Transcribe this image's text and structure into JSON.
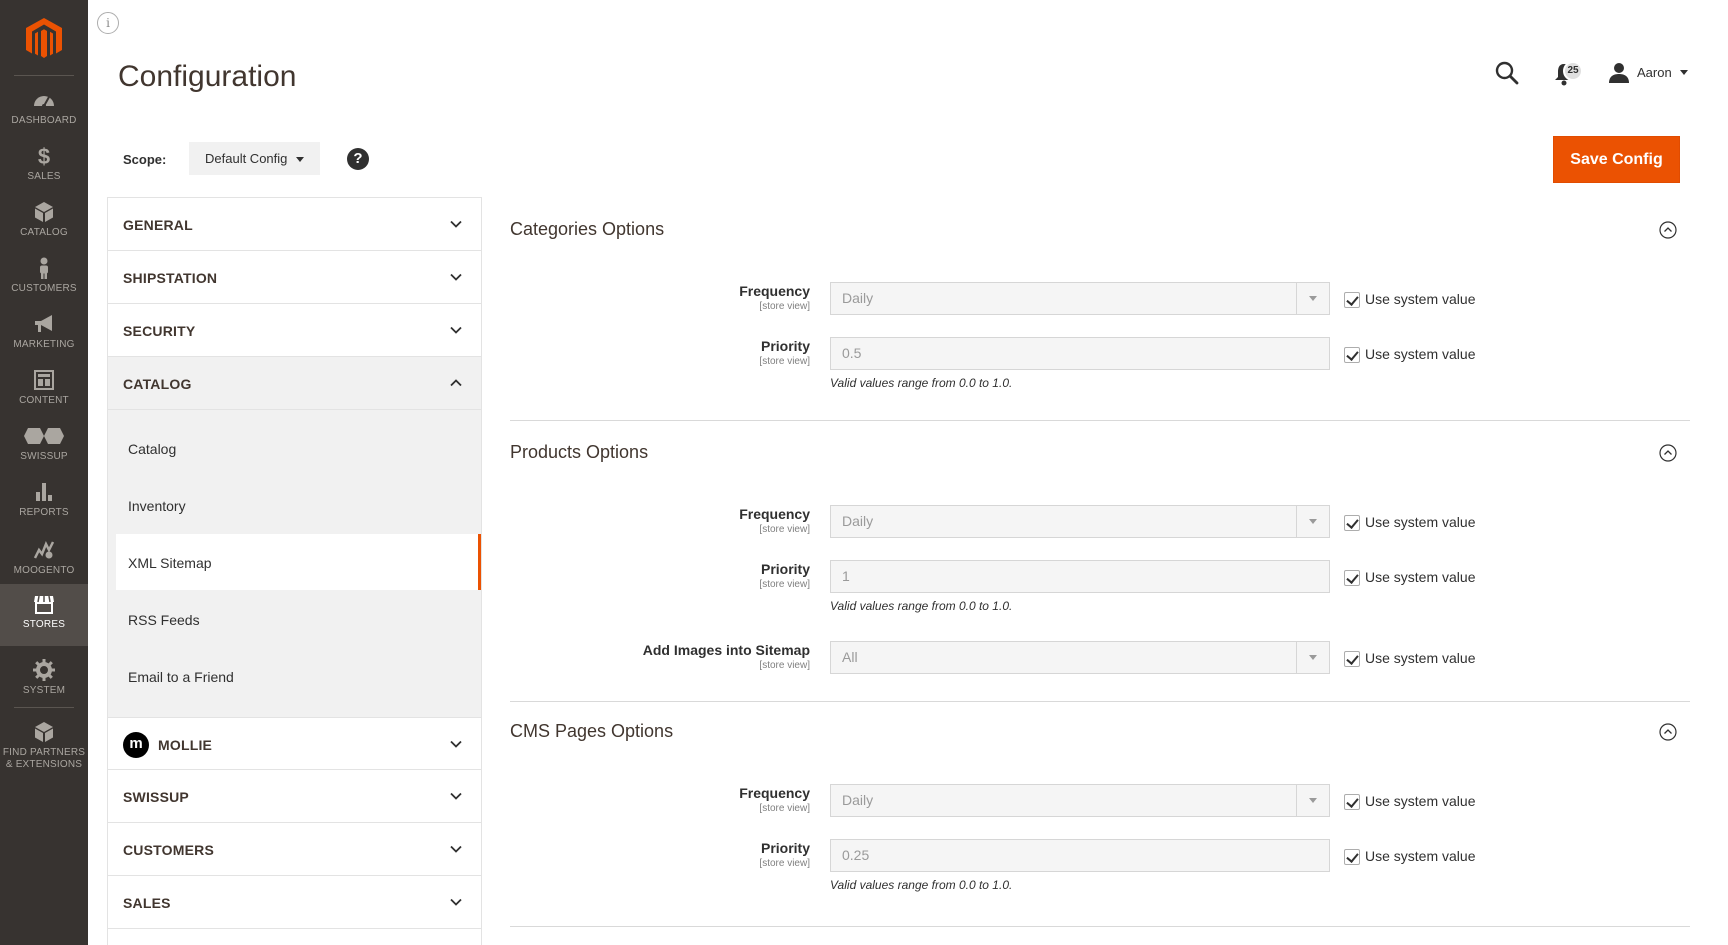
{
  "sidebar": {
    "items": [
      {
        "label": "DASHBOARD",
        "icon": "dashboard-icon"
      },
      {
        "label": "SALES",
        "icon": "dollar-icon"
      },
      {
        "label": "CATALOG",
        "icon": "box-icon"
      },
      {
        "label": "CUSTOMERS",
        "icon": "person-icon"
      },
      {
        "label": "MARKETING",
        "icon": "megaphone-icon"
      },
      {
        "label": "CONTENT",
        "icon": "layout-icon"
      },
      {
        "label": "SWISSUP",
        "icon": "swissup-icon"
      },
      {
        "label": "REPORTS",
        "icon": "bar-chart-icon"
      },
      {
        "label": "MOOGENTO",
        "icon": "moogento-icon"
      },
      {
        "label": "STORES",
        "icon": "store-icon",
        "active": true
      },
      {
        "label": "SYSTEM",
        "icon": "gear-icon"
      },
      {
        "label": "FIND PARTNERS & EXTENSIONS",
        "icon": "extensions-icon"
      }
    ]
  },
  "header": {
    "title": "Configuration",
    "notifications_count": "25",
    "user_name": "Aaron"
  },
  "scope": {
    "label": "Scope:",
    "value": "Default Config"
  },
  "actions": {
    "save_label": "Save Config"
  },
  "tabs": {
    "general": "GENERAL",
    "shipstation": "SHIPSTATION",
    "security": "SECURITY",
    "catalog": "CATALOG",
    "catalog_items": [
      "Catalog",
      "Inventory",
      "XML Sitemap",
      "RSS Feeds",
      "Email to a Friend"
    ],
    "catalog_active": "XML Sitemap",
    "mollie": "MOLLIE",
    "swissup": "SWISSUP",
    "customers": "CUSTOMERS",
    "sales": "SALES"
  },
  "common": {
    "store_view": "[store view]",
    "use_system_value": "Use system value",
    "valid_range_note": "Valid values range from 0.0 to 1.0."
  },
  "sections": {
    "categories": {
      "title": "Categories Options",
      "frequency_label": "Frequency",
      "frequency_value": "Daily",
      "priority_label": "Priority",
      "priority_value": "0.5"
    },
    "products": {
      "title": "Products Options",
      "frequency_label": "Frequency",
      "frequency_value": "Daily",
      "priority_label": "Priority",
      "priority_value": "1",
      "images_label": "Add Images into Sitemap",
      "images_value": "All"
    },
    "cms": {
      "title": "CMS Pages Options",
      "frequency_label": "Frequency",
      "frequency_value": "Daily",
      "priority_label": "Priority",
      "priority_value": "0.25"
    }
  },
  "colors": {
    "accent": "#eb5202",
    "menu_bg": "#373330",
    "menu_active": "#524d49"
  }
}
